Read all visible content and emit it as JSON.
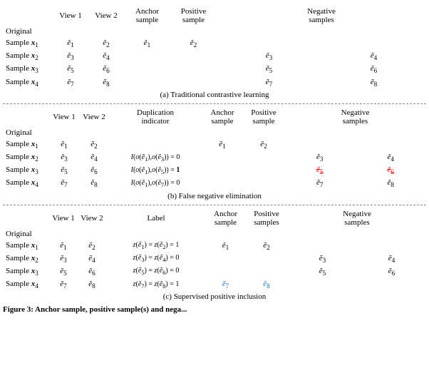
{
  "sections": [
    {
      "id": "section-a",
      "caption": "(a) Traditional contrastive learning",
      "headers": [
        {
          "id": "h-orig",
          "text": "Original"
        },
        {
          "id": "h-view1",
          "text": "View 1"
        },
        {
          "id": "h-view2",
          "text": "View 2"
        },
        {
          "id": "h-anchor",
          "text": "Anchor\nsample"
        },
        {
          "id": "h-positive",
          "text": "Positive\nsample"
        },
        {
          "id": "h-negative",
          "text": "Negative\nsamples"
        }
      ],
      "rows": [
        {
          "original": "Sample ",
          "sub": "1",
          "view1": "ẽ₁",
          "view2": "ẽ₂",
          "extra": "",
          "anchor": "ẽ₁",
          "positive": "ẽ₂",
          "neg1": "",
          "neg2": ""
        },
        {
          "original": "Sample ",
          "sub": "2",
          "view1": "ẽ₃",
          "view2": "ẽ₄",
          "extra": "",
          "anchor": "",
          "positive": "",
          "neg1": "ẽ₃",
          "neg2": "ẽ₄"
        },
        {
          "original": "Sample ",
          "sub": "3",
          "view1": "ẽ₅",
          "view2": "ẽ₆",
          "extra": "",
          "anchor": "",
          "positive": "",
          "neg1": "ẽ₅",
          "neg2": "ẽ₆"
        },
        {
          "original": "Sample ",
          "sub": "4",
          "view1": "ẽ₇",
          "view2": "ẽ₈",
          "extra": "",
          "anchor": "",
          "positive": "",
          "neg1": "ẽ₇",
          "neg2": "ẽ₈"
        }
      ]
    },
    {
      "id": "section-b",
      "caption": "(b) False negative elimination",
      "headers": [
        {
          "id": "h-orig",
          "text": "Original"
        },
        {
          "id": "h-view1",
          "text": "View 1"
        },
        {
          "id": "h-view2",
          "text": "View 2"
        },
        {
          "id": "h-dup",
          "text": "Duplication\nindicator"
        },
        {
          "id": "h-anchor",
          "text": "Anchor\nsample"
        },
        {
          "id": "h-positive",
          "text": "Positive\nsample"
        },
        {
          "id": "h-negative",
          "text": "Negative\nsamples"
        }
      ]
    },
    {
      "id": "section-c",
      "caption": "(c) Supervised positive inclusion",
      "headers": [
        {
          "id": "h-orig",
          "text": "Original"
        },
        {
          "id": "h-view1",
          "text": "View 1"
        },
        {
          "id": "h-view2",
          "text": "View 2"
        },
        {
          "id": "h-label",
          "text": "Label"
        },
        {
          "id": "h-anchor",
          "text": "Anchor\nsample"
        },
        {
          "id": "h-positive",
          "text": "Positive\nsamples"
        },
        {
          "id": "h-negative",
          "text": "Negative\nsamples"
        }
      ]
    }
  ],
  "figure_caption": "Figure 3: Anchor sample, positive sample(s) and nega..."
}
